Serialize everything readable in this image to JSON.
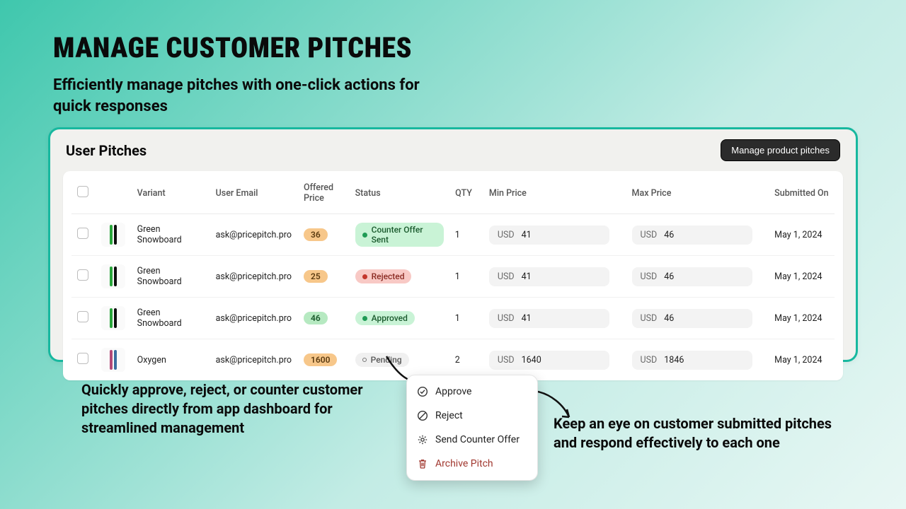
{
  "hero": {
    "title": "MANAGE CUSTOMER PITCHES",
    "subtitle": "Efficiently manage pitches with one-click actions for quick responses"
  },
  "panel": {
    "title": "User Pitches",
    "manage_button": "Manage product pitches"
  },
  "table": {
    "headers": {
      "variant": "Variant",
      "email": "User Email",
      "offered": "Offered Price",
      "status": "Status",
      "qty": "QTY",
      "min": "Min Price",
      "max": "Max Price",
      "submitted": "Submitted On"
    },
    "currency": "USD",
    "rows": [
      {
        "variant": "Green Snowboard",
        "email": "ask@pricepitch.pro",
        "offered": "36",
        "offered_style": "orange",
        "status": "Counter Offer Sent",
        "status_style": "counter",
        "qty": "1",
        "min": "41",
        "max": "46",
        "submitted": "May 1, 2024",
        "thumb_colors": [
          "#2aa63b",
          "#0d0d0d"
        ]
      },
      {
        "variant": "Green Snowboard",
        "email": "ask@pricepitch.pro",
        "offered": "25",
        "offered_style": "orange",
        "status": "Rejected",
        "status_style": "rejected",
        "qty": "1",
        "min": "41",
        "max": "46",
        "submitted": "May 1, 2024",
        "thumb_colors": [
          "#2aa63b",
          "#0d0d0d"
        ]
      },
      {
        "variant": "Green Snowboard",
        "email": "ask@pricepitch.pro",
        "offered": "46",
        "offered_style": "green",
        "status": "Approved",
        "status_style": "approved",
        "qty": "1",
        "min": "41",
        "max": "46",
        "submitted": "May 1, 2024",
        "thumb_colors": [
          "#2aa63b",
          "#0d0d0d"
        ]
      },
      {
        "variant": "Oxygen",
        "email": "ask@pricepitch.pro",
        "offered": "1600",
        "offered_style": "orange",
        "status": "Pending",
        "status_style": "pending",
        "qty": "2",
        "min": "1640",
        "max": "1846",
        "submitted": "May 1, 2024",
        "thumb_colors": [
          "#b34a78",
          "#3a6fa0"
        ]
      }
    ]
  },
  "menu": {
    "approve": "Approve",
    "reject": "Reject",
    "counter": "Send Counter Offer",
    "archive": "Archive Pitch"
  },
  "callouts": {
    "left": "Quickly approve, reject, or counter customer pitches directly from app dashboard for streamlined management",
    "right": "Keep an eye on customer submitted pitches and respond effectively to each one"
  }
}
